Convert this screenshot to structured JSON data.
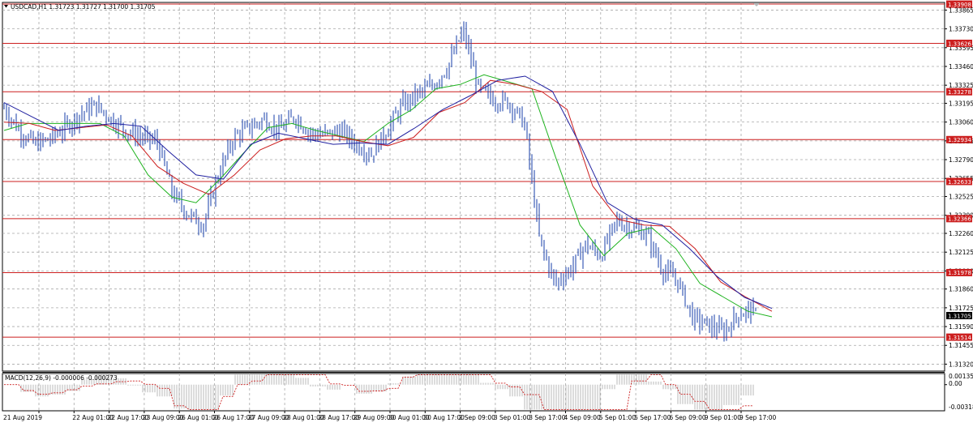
{
  "header": {
    "symbol_text": "USDCAD,H1  1.31723 1.31727 1.31700 1.31705"
  },
  "macd": {
    "label": "MACD(12,26,9) -0.000006 -0.000273",
    "ticks": [
      "0.001353",
      "0.00",
      "-0.00318"
    ]
  },
  "price_axis": {
    "ticks": [
      "1.33865",
      "1.33730",
      "1.33595",
      "1.33460",
      "1.33325",
      "1.33195",
      "1.33060",
      "1.32925",
      "1.32790",
      "1.32655",
      "1.32525",
      "1.32390",
      "1.32260",
      "1.32125",
      "1.31990",
      "1.31860",
      "1.31725",
      "1.31590",
      "1.31455",
      "1.31320"
    ]
  },
  "levels": [
    "1.33908",
    "1.33626",
    "1.33278",
    "1.32934",
    "1.32633",
    "1.32366",
    "1.31978",
    "1.31514"
  ],
  "current_price": "1.31705",
  "time_axis": {
    "labels": [
      "21 Aug 2019",
      "22 Aug 01:00",
      "22 Aug 17:00",
      "23 Aug 09:00",
      "26 Aug 01:00",
      "26 Aug 17:00",
      "27 Aug 09:00",
      "28 Aug 01:00",
      "28 Aug 17:00",
      "29 Aug 09:00",
      "30 Aug 01:00",
      "30 Aug 17:00",
      "2 Sep 09:00",
      "3 Sep 01:00",
      "3 Sep 17:00",
      "4 Sep 09:00",
      "5 Sep 01:00",
      "5 Sep 17:00",
      "6 Sep 09:00",
      "9 Sep 01:00",
      "9 Sep 17:00"
    ]
  },
  "colors": {
    "price_bars": "#2a4fb0",
    "ma_fast": "#1fb31f",
    "ma_mid": "#cc1f1f",
    "ma_slow": "#2020a0",
    "level_line": "#cc1f1f",
    "level_badge": "#cc1f1f",
    "grid": "#a8a8a8",
    "current_badge": "#000000",
    "macd_hist": "#a8a8a8",
    "macd_signal": "#cc1f1f"
  },
  "chart_data": {
    "type": "line",
    "title": "USDCAD,H1",
    "symbol": "USDCAD",
    "timeframe": "H1",
    "ohlc_last": {
      "open": 1.31723,
      "high": 1.31727,
      "low": 1.317,
      "close": 1.31705
    },
    "ylim": [
      1.3127,
      1.3392
    ],
    "x_categories": [
      "21 Aug 2019",
      "22 Aug 01:00",
      "22 Aug 17:00",
      "23 Aug 09:00",
      "26 Aug 01:00",
      "26 Aug 17:00",
      "27 Aug 09:00",
      "28 Aug 01:00",
      "28 Aug 17:00",
      "29 Aug 09:00",
      "30 Aug 01:00",
      "30 Aug 17:00",
      "2 Sep 09:00",
      "3 Sep 01:00",
      "3 Sep 17:00",
      "4 Sep 09:00",
      "5 Sep 01:00",
      "5 Sep 17:00",
      "6 Sep 09:00",
      "9 Sep 01:00",
      "9 Sep 17:00"
    ],
    "series": [
      {
        "name": "price",
        "values": [
          1.3316,
          1.33,
          1.329,
          1.3294,
          1.3302,
          1.3312,
          1.3318,
          1.3308,
          1.33,
          1.3295,
          1.3292,
          1.3255,
          1.324,
          1.3232,
          1.3268,
          1.3295,
          1.3302,
          1.3308,
          1.33,
          1.331,
          1.3298,
          1.3297,
          1.33,
          1.329,
          1.3283,
          1.33,
          1.3318,
          1.3326,
          1.3332,
          1.3346,
          1.3372,
          1.333,
          1.3322,
          1.332,
          1.3305,
          1.322,
          1.319,
          1.32,
          1.3218,
          1.321,
          1.3235,
          1.323,
          1.3225,
          1.32,
          1.3192,
          1.3165,
          1.316,
          1.3155,
          1.3168,
          1.3172
        ]
      },
      {
        "name": "",
        "values": [
          1.33,
          1.3305,
          1.3305,
          1.3305,
          1.3305,
          1.3296,
          1.3268,
          1.3252,
          1.3248,
          1.3265,
          1.3284,
          1.3302,
          1.3305,
          1.33,
          1.3296,
          1.3292,
          1.3305,
          1.3315,
          1.333,
          1.3333,
          1.334,
          1.3335,
          1.333,
          1.328,
          1.3232,
          1.321,
          1.3226,
          1.323,
          1.3215,
          1.319,
          1.318,
          1.317,
          1.3166
        ]
      },
      {
        "name": "",
        "values": [
          1.3306,
          1.3305,
          1.33,
          1.3302,
          1.3304,
          1.3296,
          1.3274,
          1.3262,
          1.3254,
          1.3268,
          1.3286,
          1.3294,
          1.3296,
          1.3296,
          1.3292,
          1.3289,
          1.3295,
          1.3313,
          1.332,
          1.3336,
          1.3333,
          1.3328,
          1.3315,
          1.326,
          1.3236,
          1.3232,
          1.3231,
          1.3215,
          1.3191,
          1.318,
          1.317
        ]
      },
      {
        "name": "",
        "values": [
          1.332,
          1.331,
          1.33,
          1.3303,
          1.3305,
          1.3303,
          1.3285,
          1.3268,
          1.3265,
          1.329,
          1.3298,
          1.3294,
          1.329,
          1.3291,
          1.329,
          1.3302,
          1.3315,
          1.3325,
          1.3336,
          1.3339,
          1.3328,
          1.329,
          1.3248,
          1.3236,
          1.3232,
          1.3215,
          1.3195,
          1.318,
          1.3172
        ]
      }
    ],
    "horizontal_levels": [
      1.33908,
      1.33626,
      1.33278,
      1.32934,
      1.32633,
      1.32366,
      1.31978,
      1.31514
    ],
    "macd": {
      "fast": 12,
      "slow": 26,
      "signal": 9,
      "main": -6e-06,
      "signal_value": -0.000273,
      "ylim": [
        -0.00318,
        0.001353
      ]
    }
  }
}
